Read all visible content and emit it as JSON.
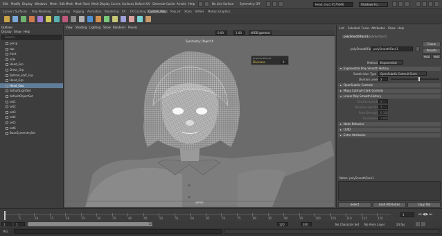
{
  "topbar": {
    "menus": [
      "Edit",
      "Modify",
      "Display",
      "Windows",
      "Mesh",
      "Edit Mesh",
      "Mesh Tools",
      "Mesh Display",
      "Curves",
      "Surfaces",
      "Deform",
      "UV",
      "Generate",
      "Cache",
      "Arnold",
      "Help"
    ],
    "workspace_label": "No Live Surface",
    "symmetry_label": "Symmetry: Off",
    "scene_field": "Head_Grp1:0576666",
    "workspace_menu": "Shadows Fo..."
  },
  "shelf": {
    "tabs": [
      "Curves / Surfaces",
      "Poly Modeling",
      "Sculpting",
      "Rigging",
      "Animation",
      "Rendering",
      "FX",
      "FX Caching",
      "Custom_Poly",
      "Poly_Hr",
      "XGen",
      "MASH",
      "Motion Graphics"
    ],
    "active_tab": "Custom_Poly",
    "colors": [
      "#c9a24a",
      "#7aa7d6",
      "#6fb36f",
      "#d07a4f",
      "#a07ad0",
      "#d0c95a",
      "#5ab0b0",
      "#c05a7a",
      "#8a8a8a",
      "#b0b0b0",
      "#4f8fd0",
      "#d0904f",
      "#79c779",
      "#c7c779",
      "#9f9fd9",
      "#d9a0a0",
      "#7ad0d0",
      "#c49a6c"
    ]
  },
  "outliner": {
    "title": "Outliner",
    "menus": [
      "Display",
      "Show",
      "Help"
    ],
    "search_placeholder": "Search...",
    "items": [
      {
        "label": "persp",
        "selected": false
      },
      {
        "label": "top",
        "selected": false
      },
      {
        "label": "front",
        "selected": false
      },
      {
        "label": "side",
        "selected": false
      },
      {
        "label": "Head_Grp",
        "selected": false
      },
      {
        "label": "Dress_Grp",
        "selected": false
      },
      {
        "label": "Bottom_Half_Grp",
        "selected": false
      },
      {
        "label": "Hand_Grp",
        "selected": false
      },
      {
        "label": "Head_Geo",
        "selected": true
      },
      {
        "label": "defaultLightSet",
        "selected": false
      },
      {
        "label": "defaultObjectSet",
        "selected": false
      },
      {
        "label": "set1",
        "selected": false
      },
      {
        "label": "set2",
        "selected": false
      },
      {
        "label": "set3",
        "selected": false
      },
      {
        "label": "set4",
        "selected": false
      },
      {
        "label": "set5",
        "selected": false
      },
      {
        "label": "set6",
        "selected": false
      },
      {
        "label": "BaseSymmetrySet",
        "selected": false
      }
    ]
  },
  "viewport": {
    "menus": [
      "View",
      "Shading",
      "Lighting",
      "Show",
      "Renderer",
      "Panels"
    ],
    "title": "Symmetry: Object X",
    "camera": "persp",
    "field_a": "0.00",
    "field_b": "1.00",
    "color_space": "sRGB gamma",
    "popup_title": "polySmoothFace1",
    "popup_label": "Divisions",
    "popup_value": "2"
  },
  "attribute_editor": {
    "menus": [
      "List",
      "Selected",
      "Focus",
      "Attributes",
      "Show",
      "Help"
    ],
    "tabs": [
      "polySmoothFace1",
      "polySurface1"
    ],
    "node_label": "polySmoothFace:",
    "node_value": "polySmoothFace1",
    "focus_label": "Focus",
    "presets_label": "Presets",
    "show_label": "Show",
    "hide_label": "Hide",
    "method_label": "Method",
    "method_value": "Exponential",
    "sections": [
      {
        "label": "Exponential Poly Smooth History",
        "open": true
      },
      {
        "label": "OpenSubdiv Controls",
        "open": false
      },
      {
        "label": "Maya Catmull-Clark Controls",
        "open": false
      },
      {
        "label": "Linear Poly Smooth History",
        "open": true
      },
      {
        "label": "Node Behavior",
        "open": false
      },
      {
        "label": "UUID",
        "open": false
      },
      {
        "label": "Extra Attributes",
        "open": false
      }
    ],
    "subdiv_type_label": "Subdivision Type",
    "subdiv_type_value": "OpenSubdiv Catmull-Clark",
    "division_levels_label": "Division Levels",
    "division_levels_value": "2",
    "linear_fields": [
      {
        "label": "Division Levels",
        "value": "1"
      },
      {
        "label": "Divisions per Face",
        "value": "1"
      },
      {
        "label": "Push Strength",
        "value": "0.100"
      },
      {
        "label": "Roundness",
        "value": "1.000"
      }
    ],
    "notes_label": "Notes:  polySmoothFace1",
    "select_label": "Select",
    "load_attributes_label": "Load Attributes",
    "copy_tab_label": "Copy Tab"
  },
  "timeline": {
    "ticks": [
      "5",
      "10",
      "15",
      "20",
      "25",
      "30",
      "35",
      "40",
      "45",
      "50",
      "55",
      "60",
      "65",
      "70",
      "75",
      "80",
      "85",
      "90",
      "95",
      "100",
      "105",
      "110",
      "115",
      "120"
    ],
    "current_frame": "1"
  },
  "range": {
    "start": "1",
    "playback_start": "1",
    "playback_end": "120",
    "end": "120",
    "total_end": "200",
    "char_set": "No Character Set",
    "anim_layer": "No Anim Layer",
    "fps": "24 fps"
  }
}
